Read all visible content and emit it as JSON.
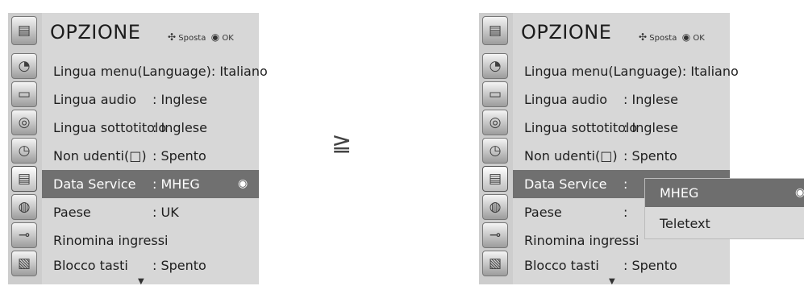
{
  "left_menu": {
    "title": "OPZIONE",
    "hint_move": "Sposta",
    "hint_ok": "OK",
    "items": [
      {
        "label": "Lingua menu(Language): Italiano",
        "value": ""
      },
      {
        "label": "Lingua audio",
        "value": ": Inglese"
      },
      {
        "label": "Lingua sottotitolo",
        "value": ": Inglese"
      },
      {
        "label": "Non udenti(□)",
        "value": ": Spento"
      },
      {
        "label": "Data Service",
        "value": ": MHEG",
        "marker": "◉"
      },
      {
        "label": "Paese",
        "value": ": UK"
      },
      {
        "label": "Rinomina ingressi",
        "value": ""
      },
      {
        "label": "Blocco tasti",
        "value": ": Spento"
      }
    ]
  },
  "separator": "≧",
  "right_menu": {
    "title": "OPZIONE",
    "hint_move": "Sposta",
    "hint_ok": "OK",
    "items": [
      {
        "label": "Lingua menu(Language): Italiano",
        "value": ""
      },
      {
        "label": "Lingua audio",
        "value": ": Inglese"
      },
      {
        "label": "Lingua sottotitolo",
        "value": ": Inglese"
      },
      {
        "label": "Non udenti(□)",
        "value": ": Spento"
      },
      {
        "label": "Data Service",
        "value": ":"
      },
      {
        "label": "Paese",
        "value": ":"
      },
      {
        "label": "Rinomina ingressi",
        "value": ""
      },
      {
        "label": "Blocco tasti",
        "value": ": Spento"
      }
    ]
  },
  "popup": {
    "options": [
      "MHEG",
      "Teletext"
    ],
    "selected_marker": "◉"
  },
  "icons": [
    "option-tools-icon",
    "satellite-dish-icon",
    "tv-screen-icon",
    "speaker-icon",
    "clock-icon",
    "option-tools-icon",
    "padlock-icon",
    "plug-input-icon",
    "picture-icon"
  ],
  "colors": {
    "highlight": "#707070",
    "panel": "#d7d7d7"
  }
}
